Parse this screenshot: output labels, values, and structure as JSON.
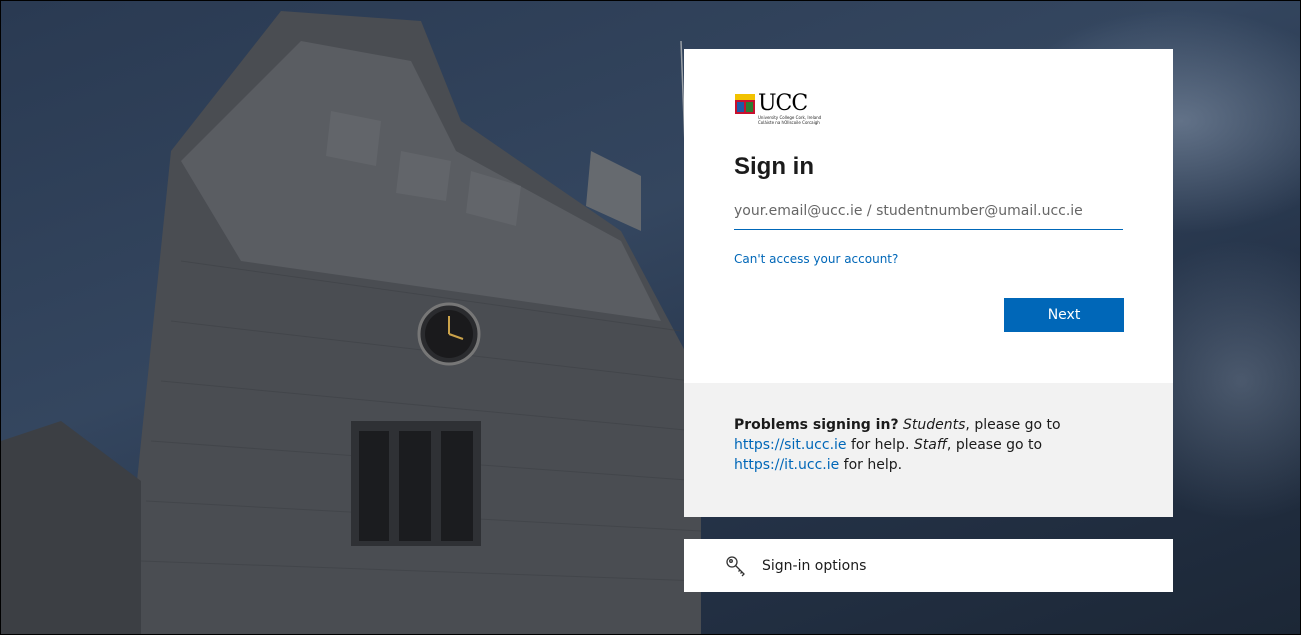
{
  "brand": {
    "name": "UCC",
    "subtitle_en": "University College Cork, Ireland",
    "subtitle_ga": "Coláiste na hOllscoile Corcaigh"
  },
  "signin": {
    "title": "Sign in",
    "email_placeholder": "your.email@ucc.ie / studentnumber@umail.ucc.ie",
    "email_value": "",
    "cant_access_label": "Can't access your account?",
    "next_label": "Next"
  },
  "help": {
    "heading": "Problems signing in?",
    "students_word": "Students",
    "text_1": ", please go to",
    "sit_link": "https://sit.ucc.ie",
    "text_2": " for help. ",
    "staff_word": "Staff",
    "text_3": ", please go to",
    "it_link": "https://it.ucc.ie",
    "text_4": " for help."
  },
  "options": {
    "label": "Sign-in options"
  },
  "colors": {
    "accent": "#0067b8",
    "help_bg": "#f2f2f2"
  },
  "icons": {
    "options": "key-icon",
    "logo": "ucc-crest-icon"
  }
}
